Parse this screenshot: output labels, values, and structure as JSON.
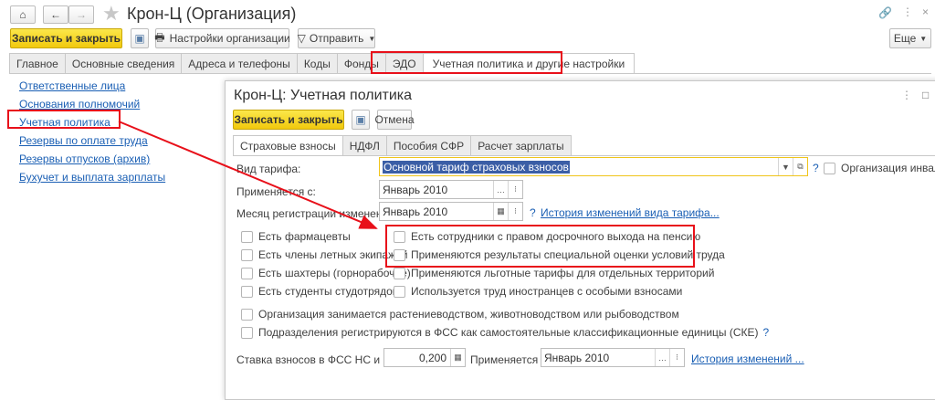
{
  "main": {
    "title": "Крон-Ц (Организация)",
    "save_close": "Записать и закрыть",
    "settings": "Настройки организации",
    "send": "Отправить",
    "more": "Еще",
    "tabs": [
      "Главное",
      "Основные сведения",
      "Адреса и телефоны",
      "Коды",
      "Фонды",
      "ЭДО",
      "Учетная политика и другие настройки"
    ],
    "links": [
      "Ответственные лица",
      "Основания полномочий",
      "Учетная политика",
      "Резервы по оплате труда",
      "Резервы отпусков (архив)",
      "Бухучет и выплата зарплаты"
    ]
  },
  "dialog": {
    "title": "Крон-Ц: Учетная политика",
    "save_close": "Записать и закрыть",
    "cancel": "Отмена",
    "tabs": [
      "Страховые взносы",
      "НДФЛ",
      "Пособия СФР",
      "Расчет зарплаты"
    ],
    "tariff_label": "Вид тарифа:",
    "tariff_value": "Основной тариф страховых взносов",
    "disabled_org": "Организация инвалидо",
    "applies_label": "Применяется с:",
    "applies_value": "Январь 2010",
    "month_label": "Месяц регистрации изменений:",
    "month_value": "Январь 2010",
    "history_tariff": "История изменений вида тарифа...",
    "left_checks": [
      "Есть фармацевты",
      "Есть члены летных экипажей",
      "Есть шахтеры (горнорабочие)",
      "Есть студенты студотрядов"
    ],
    "right_checks": [
      "Есть сотрудники с правом досрочного выхода на пенсию",
      "Применяются результаты специальной оценки условий труда",
      "Применяются льготные тарифы для отдельных территорий",
      "Используется труд иностранцев с особыми взносами"
    ],
    "agri": "Организация занимается растениеводством, животноводством или рыбоводством",
    "ske": "Подразделения регистрируются в ФСС как самостоятельные классификационные единицы (СКЕ)",
    "rate_label": "Ставка взносов в ФСС НС и ПЗ:",
    "rate_value": "0,200",
    "rate_applies_label": "Применяется с:",
    "rate_applies_value": "Январь 2010",
    "history": "История изменений ...",
    "help": "?"
  }
}
